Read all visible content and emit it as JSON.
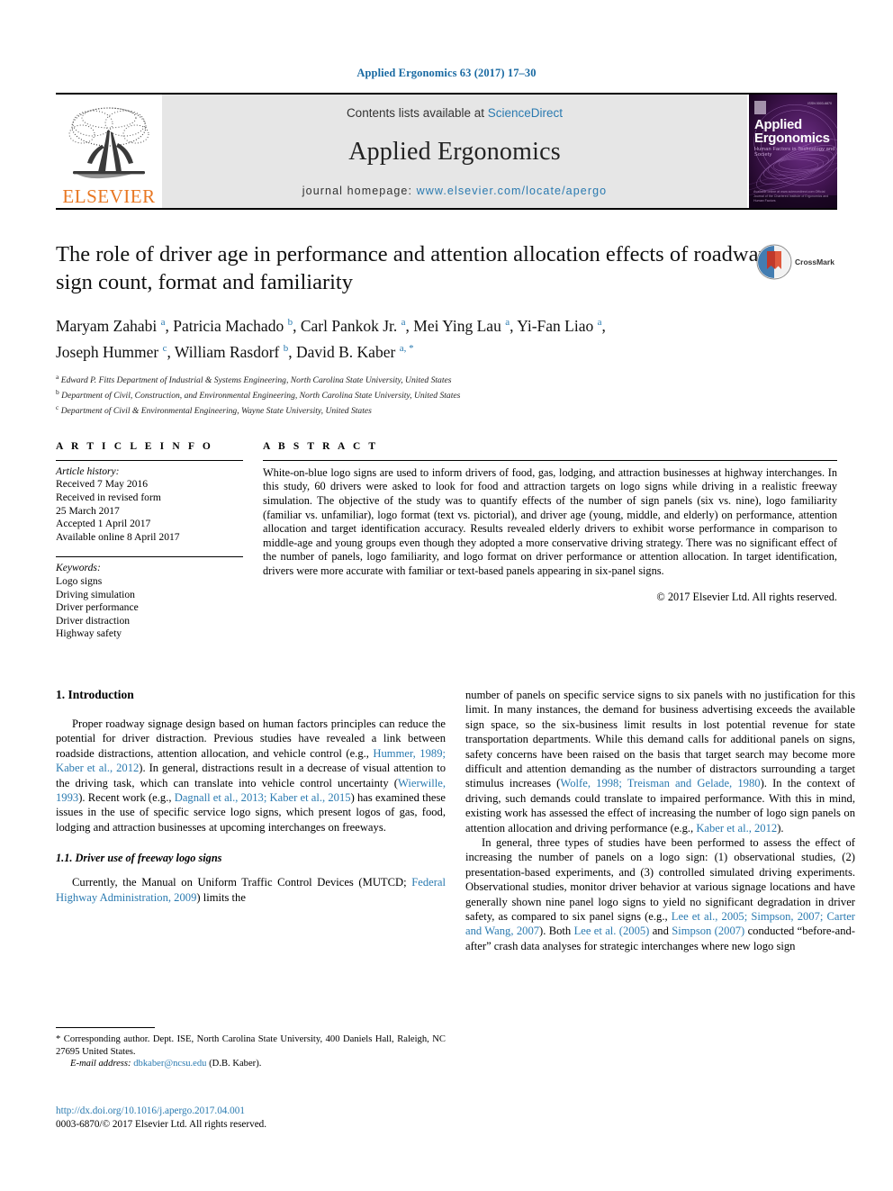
{
  "running_head": "Applied Ergonomics 63 (2017) 17–30",
  "masthead": {
    "contents_prefix": "Contents lists available at ",
    "contents_link": "ScienceDirect",
    "journal_title": "Applied Ergonomics",
    "homepage_prefix": "journal homepage: ",
    "homepage_url": "www.elsevier.com/locate/apergo",
    "publisher": "ELSEVIER",
    "cover": {
      "line1": "Applied",
      "line2": "Ergonomics",
      "tagline": "Human Factors in Technology and Society",
      "issn_tag": "ISSN 0003-6870",
      "footer": "Available online at www.sciencedirect.com\nOfficial Journal of the Chartered Institute of Ergonomics and Human Factors"
    }
  },
  "article": {
    "title": "The role of driver age in performance and attention allocation effects of roadway sign count, format and familiarity",
    "crossmark_label": "CrossMark",
    "authors_line1": "Maryam Zahabi <sup>a</sup>, Patricia Machado <sup>b</sup>, Carl Pankok Jr. <sup>a</sup>, Mei Ying Lau <sup>a</sup>, Yi-Fan Liao <sup>a</sup>,",
    "authors_line2": "Joseph Hummer <sup>c</sup>, William Rasdorf <sup>b</sup>, David B. Kaber <sup>a, *</sup>",
    "affiliations": [
      "<sup>a</sup> Edward P. Fitts Department of Industrial &amp; Systems Engineering, North Carolina State University, United States",
      "<sup>b</sup> Department of Civil, Construction, and Environmental Engineering, North Carolina State University, United States",
      "<sup>c</sup> Department of Civil &amp; Environmental Engineering, Wayne State University, United States"
    ]
  },
  "article_info": {
    "heading": "A R T I C L E  I N F O",
    "history_label": "Article history:",
    "history": [
      "Received 7 May 2016",
      "Received in revised form",
      "25 March 2017",
      "Accepted 1 April 2017",
      "Available online 8 April 2017"
    ],
    "keywords_label": "Keywords:",
    "keywords": [
      "Logo signs",
      "Driving simulation",
      "Driver performance",
      "Driver distraction",
      "Highway safety"
    ]
  },
  "abstract": {
    "heading": "A B S T R A C T",
    "text": "White-on-blue logo signs are used to inform drivers of food, gas, lodging, and attraction businesses at highway interchanges. In this study, 60 drivers were asked to look for food and attraction targets on logo signs while driving in a realistic freeway simulation. The objective of the study was to quantify effects of the number of sign panels (six vs. nine), logo familiarity (familiar vs. unfamiliar), logo format (text vs. pictorial), and driver age (young, middle, and elderly) on performance, attention allocation and target identification accuracy. Results revealed elderly drivers to exhibit worse performance in comparison to middle-age and young groups even though they adopted a more conservative driving strategy. There was no significant effect of the number of panels, logo familiarity, and logo format on driver performance or attention allocation. In target identification, drivers were more accurate with familiar or text-based panels appearing in six-panel signs.",
    "copyright": "© 2017 Elsevier Ltd. All rights reserved."
  },
  "body": {
    "section1_heading": "1.  Introduction",
    "left_p1": "Proper roadway signage design based on human factors principles can reduce the potential for driver distraction. Previous studies have revealed a link between roadside distractions, attention allocation, and vehicle control (e.g., <a class=\"ref\" href=\"#\">Hummer, 1989; Kaber et al., 2012</a>). In general, distractions result in a decrease of visual attention to the driving task, which can translate into vehicle control uncertainty (<a class=\"ref\" href=\"#\">Wierwille, 1993</a>). Recent work (e.g., <a class=\"ref\" href=\"#\">Dagnall et al., 2013; Kaber et al., 2015</a>) has examined these issues in the use of specific service logo signs, which present logos of gas, food, lodging and attraction businesses at upcoming interchanges on freeways.",
    "subsection_heading": "1.1.  Driver use of freeway logo signs",
    "left_p2": "Currently, the Manual on Uniform Traffic Control Devices (MUTCD; <a class=\"ref\" href=\"#\">Federal Highway Administration, 2009</a>) limits the",
    "right_p1": "number of panels on specific service signs to six panels with no justification for this limit. In many instances, the demand for business advertising exceeds the available sign space, so the six-business limit results in lost potential revenue for state transportation departments. While this demand calls for additional panels on signs, safety concerns have been raised on the basis that target search may become more difficult and attention demanding as the number of distractors surrounding a target stimulus increases (<a class=\"ref\" href=\"#\">Wolfe, 1998; Treisman and Gelade, 1980</a>). In the context of driving, such demands could translate to impaired performance. With this in mind, existing work has assessed the effect of increasing the number of logo sign panels on attention allocation and driving performance (e.g., <a class=\"ref\" href=\"#\">Kaber et al., 2012</a>).",
    "right_p2": "In general, three types of studies have been performed to assess the effect of increasing the number of panels on a logo sign: (1) observational studies, (2) presentation-based experiments, and (3) controlled simulated driving experiments. Observational studies, monitor driver behavior at various signage locations and have generally shown nine panel logo signs to yield no significant degradation in driver safety, as compared to six panel signs (e.g., <a class=\"ref\" href=\"#\">Lee et al., 2005; Simpson, 2007; Carter and Wang, 2007</a>). Both <a class=\"ref\" href=\"#\">Lee et al. (2005)</a> and <a class=\"ref\" href=\"#\">Simpson (2007)</a> conducted “before-and-after” crash data analyses for strategic interchanges where new logo sign"
  },
  "footnote": {
    "corresponding": "* Corresponding author. Dept. ISE, North Carolina State University, 400 Daniels Hall, Raleigh, NC 27695 United States.",
    "email_label": "E-mail address:",
    "email": "dbkaber@ncsu.edu",
    "email_suffix": "(D.B. Kaber)."
  },
  "doi_block": {
    "doi_url": "http://dx.doi.org/10.1016/j.apergo.2017.04.001",
    "issn_line": "0003-6870/© 2017 Elsevier Ltd. All rights reserved."
  },
  "colors": {
    "link_blue": "#2a7ab0",
    "runhead_blue": "#1a6aa2",
    "elsevier_orange": "#E87722",
    "masthead_gray": "#e6e6e6"
  }
}
